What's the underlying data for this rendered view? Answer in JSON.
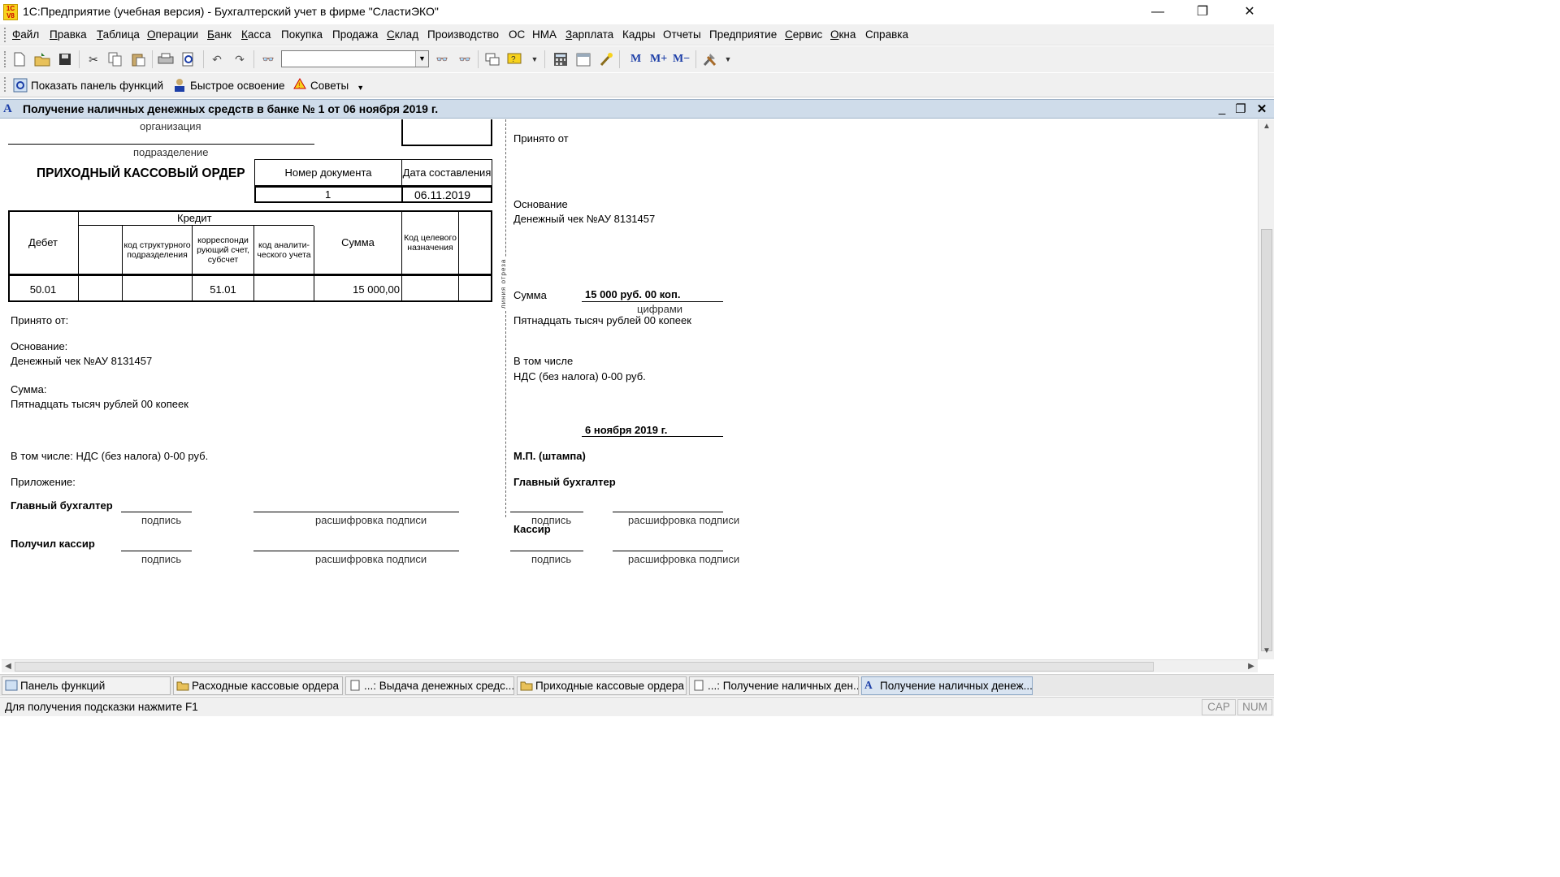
{
  "window": {
    "title": "1С:Предприятие (учебная версия) - Бухгалтерский учет в фирме \"СластиЭКО\"",
    "icon_text": "1C V8",
    "minimize": "—",
    "restore": "❐",
    "close": "✕"
  },
  "menu": [
    {
      "pre": "",
      "ul": "Ф",
      "post": "айл"
    },
    {
      "pre": "",
      "ul": "П",
      "post": "равка"
    },
    {
      "pre": "",
      "ul": "Т",
      "post": "аблица"
    },
    {
      "pre": "",
      "ul": "О",
      "post": "перации"
    },
    {
      "pre": "",
      "ul": "Б",
      "post": "анк"
    },
    {
      "pre": "",
      "ul": "К",
      "post": "асса"
    },
    {
      "pre": "",
      "ul": "",
      "post": "Покупка"
    },
    {
      "pre": "",
      "ul": "",
      "post": "Продажа"
    },
    {
      "pre": "",
      "ul": "С",
      "post": "клад"
    },
    {
      "pre": "",
      "ul": "",
      "post": "Производство"
    },
    {
      "pre": "",
      "ul": "",
      "post": "ОС"
    },
    {
      "pre": "",
      "ul": "",
      "post": "НМА"
    },
    {
      "pre": "",
      "ul": "З",
      "post": "арплата"
    },
    {
      "pre": "",
      "ul": "",
      "post": "Кадры"
    },
    {
      "pre": "",
      "ul": "",
      "post": "Отчеты"
    },
    {
      "pre": "",
      "ul": "",
      "post": "Предприятие"
    },
    {
      "pre": "",
      "ul": "С",
      "post": "ервис"
    },
    {
      "pre": "",
      "ul": "О",
      "post": "кна"
    },
    {
      "pre": "",
      "ul": "",
      "post": "Справка"
    }
  ],
  "toolbar": {
    "search_value": "",
    "m_labels": [
      "M",
      "M+",
      "M−"
    ]
  },
  "toolbar2": {
    "show_panel": "Показать панель функций",
    "quick_learn": "Быстрое освоение",
    "tips": "Советы"
  },
  "document_window": {
    "title": "Получение наличных денежных средств в банке № 1 от 06 ноября 2019 г."
  },
  "form": {
    "org_caption": "организация",
    "dept_caption": "подразделение",
    "title": "ПРИХОДНЫЙ КАССОВЫЙ ОРДЕР",
    "doc_number_label": "Номер документа",
    "doc_date_label": "Дата составления",
    "doc_number": "1",
    "doc_date": "06.11.2019",
    "table": {
      "debit": "Дебет",
      "credit": "Кредит",
      "col_code_struct": "код структурного подразделения",
      "col_corr": "корреспонди рующий счет, субсчет",
      "col_analytic": "код аналити-ческого учета",
      "sum": "Сумма",
      "purpose": "Код целевого назначения",
      "row": {
        "debit": "50.01",
        "corr": "51.01",
        "sum": "15 000,00"
      }
    },
    "received_from": "Принято от:",
    "basis_label": "Основание:",
    "basis_value": "Денежный чек №АУ 8131457",
    "sum_label": "Сумма:",
    "sum_words": "Пятнадцать тысяч рублей 00 копеек",
    "incl": "В том числе: НДС (без налога) 0-00 руб.",
    "attachment": "Приложение:",
    "chief_accountant": "Главный бухгалтер",
    "cashier_received": "Получил кассир",
    "sign": "подпись",
    "sign_decode": "расшифровка подписи",
    "cut_line": "линия отреза"
  },
  "receipt": {
    "received_from": "Принято от",
    "basis_label": "Основание",
    "basis_value": "Денежный чек №АУ 8131457",
    "sum_label": "Сумма",
    "sum_digits": "15 000 руб. 00 коп.",
    "digits_caption": "цифрами",
    "sum_words": "Пятнадцать тысяч рублей 00 копеек",
    "incl_label": "В том числе",
    "incl_value": "НДС (без налога) 0-00 руб.",
    "date": "6 ноября 2019 г.",
    "stamp": "М.П. (штампа)",
    "chief_accountant": "Главный бухгалтер",
    "cashier": "Кассир",
    "sign": "подпись",
    "sign_decode": "расшифровка подписи"
  },
  "taskbar": [
    "Панель функций",
    "Расходные кассовые ордера",
    "...: Выдача денежных средс...",
    "Приходные кассовые ордера",
    "...: Получение наличных ден...",
    "Получение наличных денеж..."
  ],
  "status": {
    "hint": "Для получения подсказки нажмите F1",
    "cap": "CAP",
    "num": "NUM"
  },
  "colors": {
    "doc_title_bg": "#cfdcea",
    "toolbar_bg": "#f0f0f0",
    "active_task": "#d9e4f1"
  }
}
